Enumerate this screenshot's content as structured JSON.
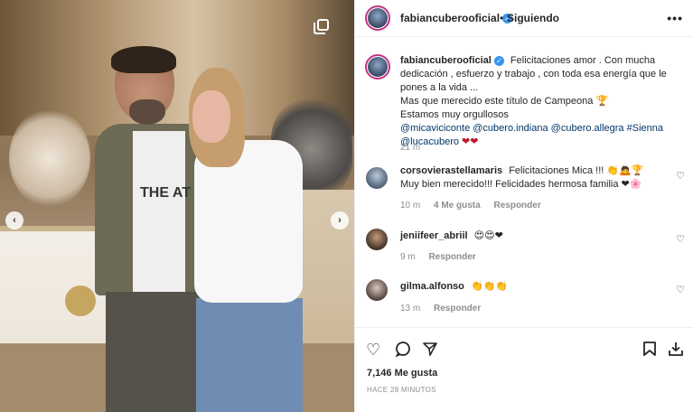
{
  "post": {
    "username": "fabiancuberooficial",
    "follow_separator": "•",
    "follow_label": "Siguiendo",
    "more_label": "•••"
  },
  "photo": {
    "shirt_text": "THE AT"
  },
  "caption": {
    "username": "fabiancuberooficial",
    "line1": "Felicitaciones amor . Con mucha dedicación , esfuerzo y trabajo , con toda esa energía que le pones a la vida ...",
    "line2": "Mas que merecido este título de Campeona 🏆",
    "line3": "Estamos muy orgullosos",
    "tag1": "@micaviciconte",
    "tag2": "@cubero.indiana",
    "tag3": "@cubero.allegra",
    "tag4": "#Sienna",
    "tag5": "@lucacubero",
    "hearts": "❤❤",
    "time": "21 m"
  },
  "comments": [
    {
      "username": "corsovierastellamaris",
      "text": "Felicitaciones Mica !!! 👏🙇🏆 Muy bien merecido!!! Felicidades hermosa familia ❤🌸",
      "time": "10 m",
      "likes": "4 Me gusta",
      "reply": "Responder"
    },
    {
      "username": "jeniifeer_abriil",
      "text": "😍😍❤",
      "time": "9 m",
      "reply": "Responder"
    },
    {
      "username": "gilma.alfonso",
      "text": "👏👏👏",
      "time": "13 m",
      "reply": "Responder"
    }
  ],
  "actions": {
    "likes": "7,146 Me gusta",
    "time_ago": "HACE 28 MINUTOS"
  },
  "icons": {
    "heart": "heart-icon",
    "comment": "comment-icon",
    "share": "share-icon",
    "save": "bookmark-icon",
    "download": "download-icon"
  }
}
